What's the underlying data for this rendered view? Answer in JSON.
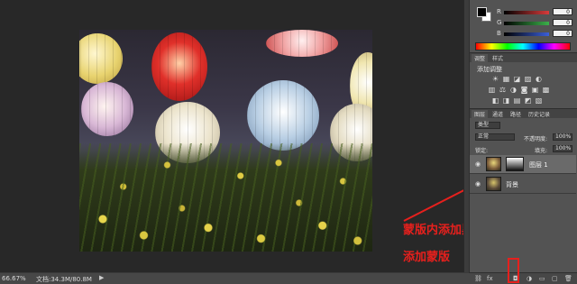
{
  "status_bar": {
    "zoom": "66.67%",
    "doc_size": "文档:34.3M/80.8M",
    "menu_arrow": "▶"
  },
  "color_panel": {
    "sliders": [
      {
        "letter": "R",
        "value": "0",
        "color": "#d83b3b"
      },
      {
        "letter": "G",
        "value": "0",
        "color": "#3bb04a"
      },
      {
        "letter": "B",
        "value": "0",
        "color": "#3b5fd8"
      }
    ]
  },
  "adjustments_panel": {
    "tabs": [
      "调整",
      "样式"
    ],
    "title": "添加调整",
    "icon_rows": [
      [
        "☀",
        "▦",
        "◪",
        "▨",
        "◐"
      ],
      [
        "▥",
        "⚖",
        "◑",
        "◙",
        "▣",
        "▩"
      ],
      [
        "◧",
        "◨",
        "▤",
        "◩",
        "▧"
      ]
    ]
  },
  "layers_panel": {
    "tabs": [
      "图层",
      "通道",
      "路径",
      "历史记录"
    ],
    "filter_kind": "类型",
    "blend_mode": "正常",
    "opacity_label": "不透明度:",
    "opacity_value": "100%",
    "lock_label": "锁定:",
    "fill_label": "填充:",
    "fill_value": "100%",
    "layers": [
      {
        "name": "图层 1",
        "selected": true,
        "has_mask": true
      },
      {
        "name": "背景",
        "selected": false,
        "has_mask": false
      }
    ],
    "footer_icons": [
      "link-icon",
      "fx-icon",
      "add-mask-icon",
      "adjustment-icon",
      "folder-icon",
      "new-layer-icon",
      "trash-icon"
    ],
    "footer_glyphs": [
      "⛓",
      "fx",
      "◘",
      "◑",
      "▭",
      "▢",
      "🗑"
    ]
  },
  "annotations": {
    "gradient_note": "蒙版内添加黑白渐变",
    "mask_note": "添加蒙版"
  },
  "colors": {
    "annotation_red": "#e6201d",
    "panel_bg": "#535353",
    "canvas_bg": "#282828"
  }
}
